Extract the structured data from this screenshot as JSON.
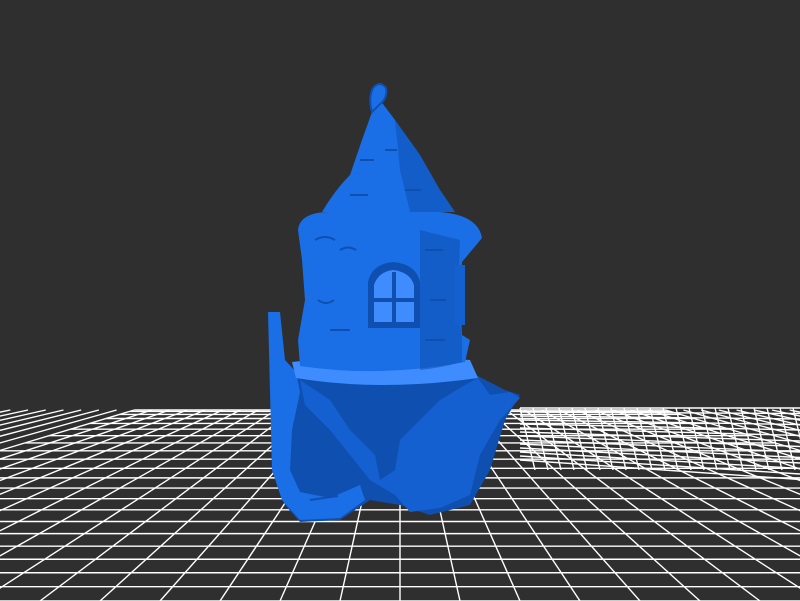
{
  "viewer": {
    "background_color": "#2f2f2f",
    "grid_color": "#ffffff",
    "model_color": "#1a6fe6",
    "model_shade_color": "#0f4fb0",
    "model_highlight_color": "#3e8cff",
    "model_name_icon": "fantasy-tower-model"
  }
}
